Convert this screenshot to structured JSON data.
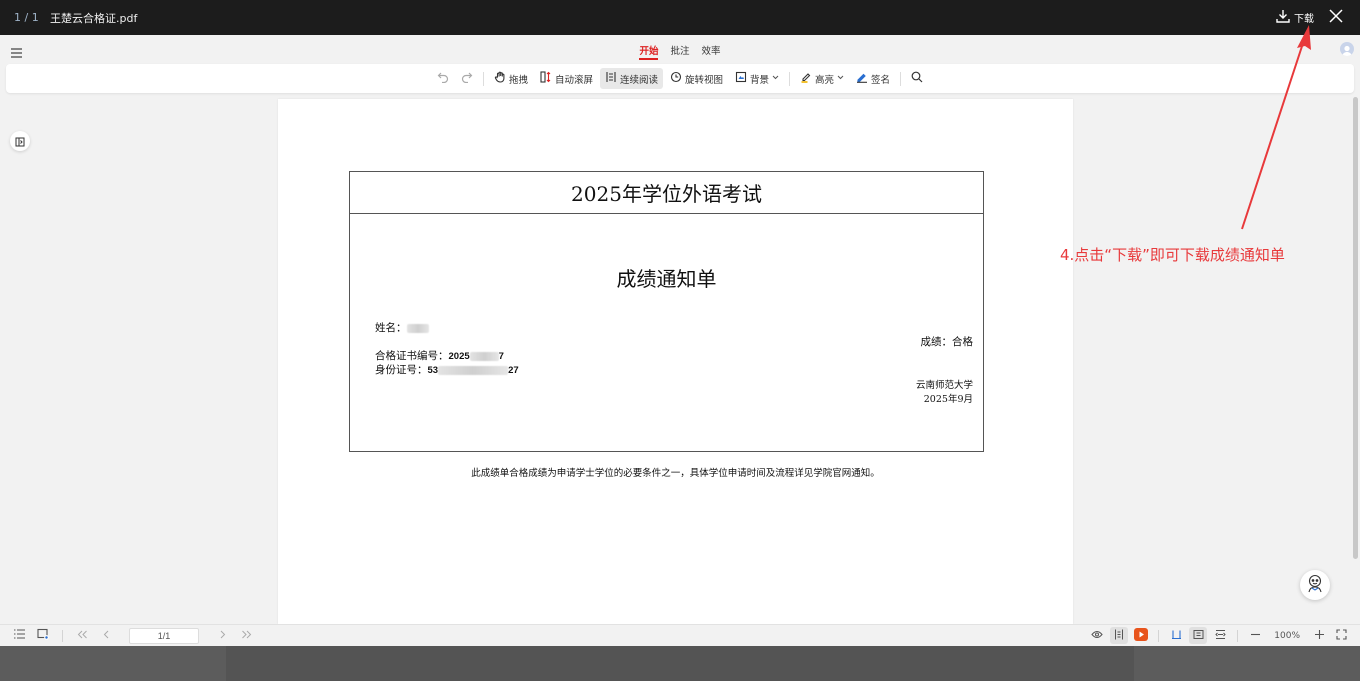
{
  "header": {
    "page_count": "1 / 1",
    "filename": "王楚云合格证.pdf",
    "download_label": "下载"
  },
  "menu": {
    "tabs": [
      {
        "label": "开始",
        "active": true
      },
      {
        "label": "批注",
        "active": false
      },
      {
        "label": "效率",
        "active": false
      }
    ]
  },
  "toolbar": {
    "drag": "拖拽",
    "auto_scroll": "自动滚屏",
    "continuous_read": "连续阅读",
    "rotate_view": "旋转视图",
    "background": "背景",
    "highlight": "高亮",
    "signature": "签名"
  },
  "document": {
    "header_title": "2025年学位外语考试",
    "title": "成绩通知单",
    "name_label": "姓名：",
    "cert_label": "合格证书编号：",
    "cert_prefix": "2025",
    "cert_suffix": "7",
    "id_label": "身份证号：",
    "id_prefix": "53",
    "id_suffix": "27",
    "score_label": "成绩：",
    "score_value": "合格",
    "university": "云南师范大学",
    "date": "2025年9月",
    "note": "此成绩单合格成绩为申请学士学位的必要条件之一，具体学位申请时间及流程详见学院官网通知。"
  },
  "annotation": {
    "text": "4.点击“下载”即可下载成绩通知单",
    "color": "#e8393b"
  },
  "footer": {
    "page_input": "1/1",
    "zoom": "100%"
  },
  "colors": {
    "accent": "#d22222",
    "topbar": "#1c1c1c",
    "arrow": "#e8393b"
  }
}
